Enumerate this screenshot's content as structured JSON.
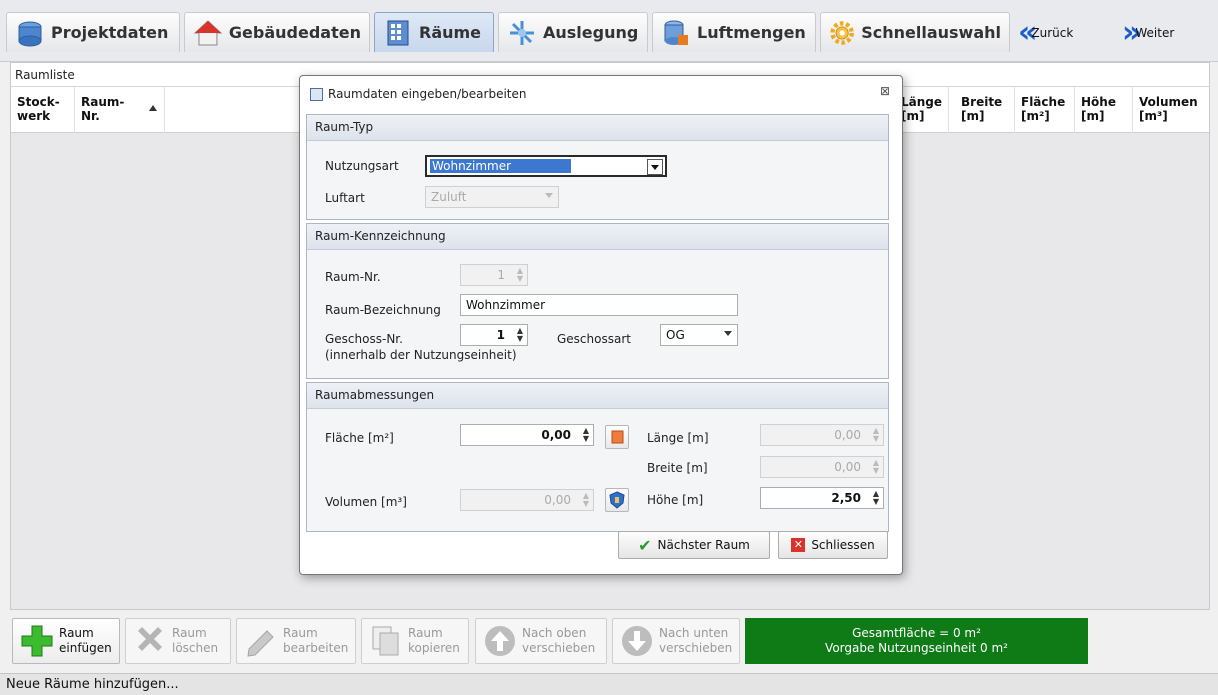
{
  "tabs": [
    {
      "label": "Projektdaten",
      "icon": "project-icon"
    },
    {
      "label": "Gebäudedaten",
      "icon": "house-icon"
    },
    {
      "label": "Räume",
      "icon": "building-icon",
      "active": true
    },
    {
      "label": "Auslegung",
      "icon": "design-icon"
    },
    {
      "label": "Luftmengen",
      "icon": "database-icon"
    },
    {
      "label": "Schnellauswahl",
      "icon": "gear-icon"
    }
  ],
  "nav": {
    "back": "Zurück",
    "next": "Weiter"
  },
  "list": {
    "title": "Raumliste",
    "columns": [
      "Stock-\nwerk",
      "Raum-\nNr.",
      "Länge\n[m]",
      "Breite\n[m]",
      "Fläche\n[m²]",
      "Höhe\n[m]",
      "Volumen\n[m³]"
    ]
  },
  "dialog": {
    "title": "Raumdaten eingeben/bearbeiten",
    "close": "⊠",
    "raumtyp": {
      "heading": "Raum-Typ",
      "nutzungsart_label": "Nutzungsart",
      "nutzungsart_value": "Wohnzimmer",
      "luftart_label": "Luftart",
      "luftart_value": "Zuluft"
    },
    "kennzeichnung": {
      "heading": "Raum-Kennzeichnung",
      "raumnr_label": "Raum-Nr.",
      "raumnr_value": "1",
      "bezeichnung_label": "Raum-Bezeichnung",
      "bezeichnung_value": "Wohnzimmer",
      "geschoss_label": "Geschoss-Nr.",
      "geschoss_sub": "(innerhalb der Nutzungseinheit)",
      "geschoss_value": "1",
      "geschossart_label": "Geschossart",
      "geschossart_value": "OG"
    },
    "abmessungen": {
      "heading": "Raumabmessungen",
      "flaeche_label": "Fläche [m²]",
      "flaeche_value": "0,00",
      "laenge_label": "Länge [m]",
      "laenge_value": "0,00",
      "breite_label": "Breite [m]",
      "breite_value": "0,00",
      "volumen_label": "Volumen [m³]",
      "volumen_value": "0,00",
      "hoehe_label": "Höhe [m]",
      "hoehe_value": "2,50"
    },
    "buttons": {
      "next": "Nächster Raum",
      "close": "Schliessen"
    }
  },
  "toolbar": [
    {
      "label1": "Raum",
      "label2": "einfügen",
      "enabled": true
    },
    {
      "label1": "Raum",
      "label2": "löschen",
      "enabled": false
    },
    {
      "label1": "Raum",
      "label2": "bearbeiten",
      "enabled": false
    },
    {
      "label1": "Raum",
      "label2": "kopieren",
      "enabled": false
    },
    {
      "label1": "Nach oben",
      "label2": "verschieben",
      "enabled": false
    },
    {
      "label1": "Nach unten",
      "label2": "verschieben",
      "enabled": false
    }
  ],
  "summary": {
    "line1": "Gesamtfläche = 0 m²",
    "line2": "Vorgabe Nutzungseinheit 0 m²"
  },
  "status": "Neue Räume hinzufügen...",
  "colors": {
    "summary_bg": "#0e7b17",
    "selection": "#3d78d0"
  }
}
